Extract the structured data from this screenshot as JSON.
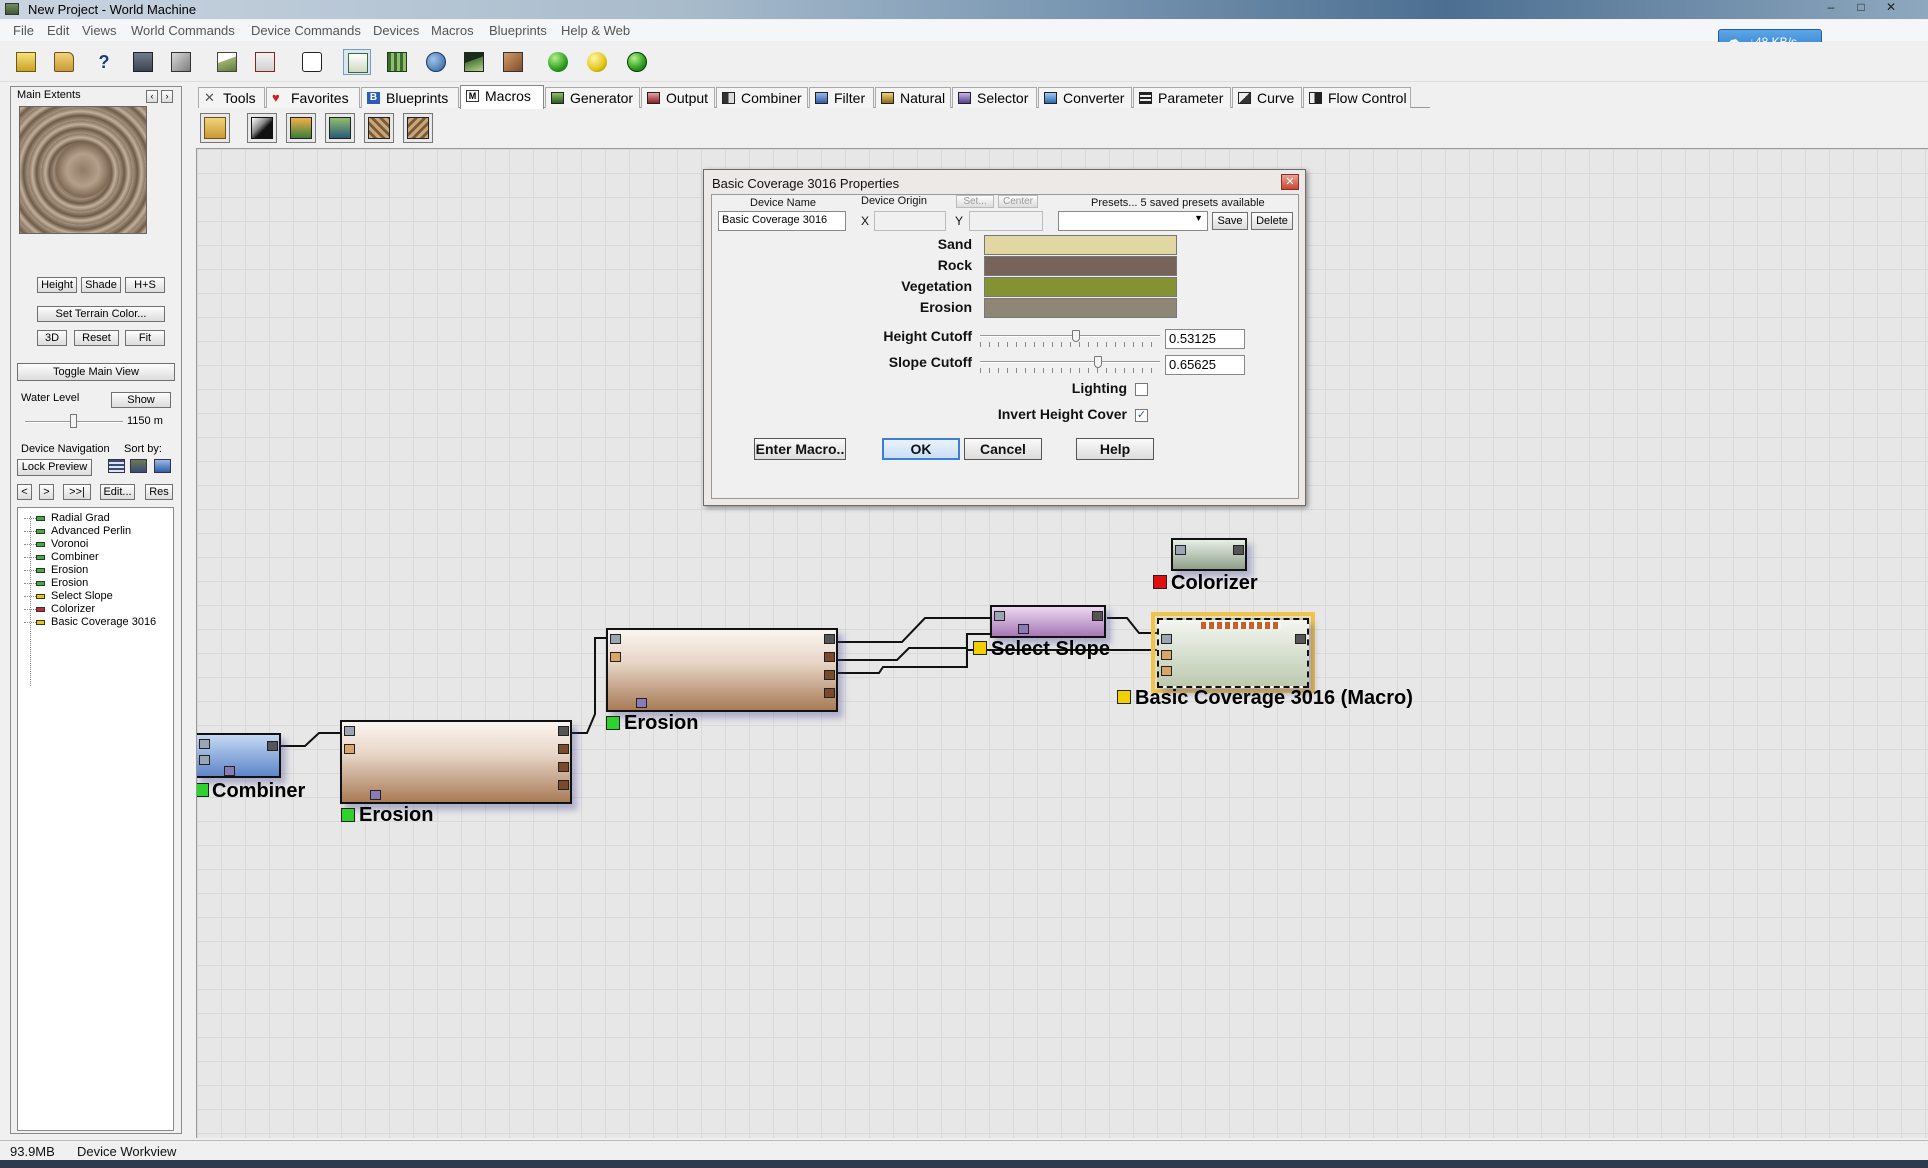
{
  "window": {
    "title": "New Project - World Machine",
    "controls": [
      "–",
      "□",
      "✕"
    ]
  },
  "menu": [
    "File",
    "Edit",
    "Views",
    "World Commands",
    "Device Commands",
    "Devices",
    "Macros",
    "Blueprints",
    "Help & Web"
  ],
  "net_speed": "48 KB/s",
  "left_panel": {
    "extents_label": "Main Extents",
    "view_buttons": [
      "Height",
      "Shade",
      "H+S"
    ],
    "set_terrain_color": "Set Terrain Color...",
    "view_buttons2": [
      "3D",
      "Reset",
      "Fit"
    ],
    "toggle_main_view": "Toggle Main View",
    "water_level_label": "Water Level",
    "show_button": "Show",
    "water_level_value": "1150 m",
    "water_level_fraction": 0.5,
    "device_navigation_label": "Device Navigation",
    "sort_by_label": "Sort by:",
    "lock_preview": "Lock Preview",
    "nav_buttons": [
      "<",
      ">",
      ">>|"
    ],
    "edit_button": "Edit...",
    "res_button": "Res",
    "tree": [
      {
        "label": "Radial Grad",
        "color": "#3bb33b"
      },
      {
        "label": "Advanced Perlin",
        "color": "#3bb33b"
      },
      {
        "label": "Voronoi",
        "color": "#3bb33b"
      },
      {
        "label": "Combiner",
        "color": "#3bb33b"
      },
      {
        "label": "Erosion",
        "color": "#3bb33b"
      },
      {
        "label": "Erosion",
        "color": "#3bb33b"
      },
      {
        "label": "Select Slope",
        "color": "#e6c619"
      },
      {
        "label": "Colorizer",
        "color": "#c42a2a"
      },
      {
        "label": "Basic Coverage 3016",
        "color": "#e6c619"
      }
    ]
  },
  "tabs": [
    "Tools",
    "Favorites",
    "Blueprints",
    "Macros",
    "Generator",
    "Output",
    "Combiner",
    "Filter",
    "Natural",
    "Selector",
    "Converter",
    "Parameter",
    "Curve",
    "Flow Control"
  ],
  "active_tab": "Macros",
  "workspace": {
    "nodes": {
      "combiner": "Combiner",
      "erosion1": "Erosion",
      "erosion2": "Erosion",
      "select_slope": "Select Slope",
      "colorizer": "Colorizer",
      "basic_coverage": "Basic Coverage 3016 (Macro)"
    }
  },
  "dialog": {
    "title": "Basic Coverage 3016 Properties",
    "close": "✕",
    "device_name_label": "Device Name",
    "device_name_value": "Basic Coverage 3016",
    "device_origin_label": "Device Origin",
    "set_button": "Set...",
    "center_button": "Center",
    "x_label": "X",
    "y_label": "Y",
    "presets_label": "Presets... 5 saved presets available",
    "save_button": "Save",
    "delete_button": "Delete",
    "colors": [
      {
        "label": "Sand",
        "color": "#e1d7a3"
      },
      {
        "label": "Rock",
        "color": "#76645a"
      },
      {
        "label": "Vegetation",
        "color": "#849233"
      },
      {
        "label": "Erosion",
        "color": "#8e8775"
      }
    ],
    "height_cutoff_label": "Height Cutoff",
    "height_cutoff_value": "0.53125",
    "slope_cutoff_label": "Slope Cutoff",
    "slope_cutoff_value": "0.65625",
    "lighting_label": "Lighting",
    "lighting_checked": false,
    "invert_label": "Invert Height Cover",
    "invert_checked": true,
    "enter_macro": "Enter Macro..",
    "ok": "OK",
    "cancel": "Cancel",
    "help": "Help"
  },
  "status": {
    "memory": "93.9MB",
    "view": "Device Workview"
  }
}
